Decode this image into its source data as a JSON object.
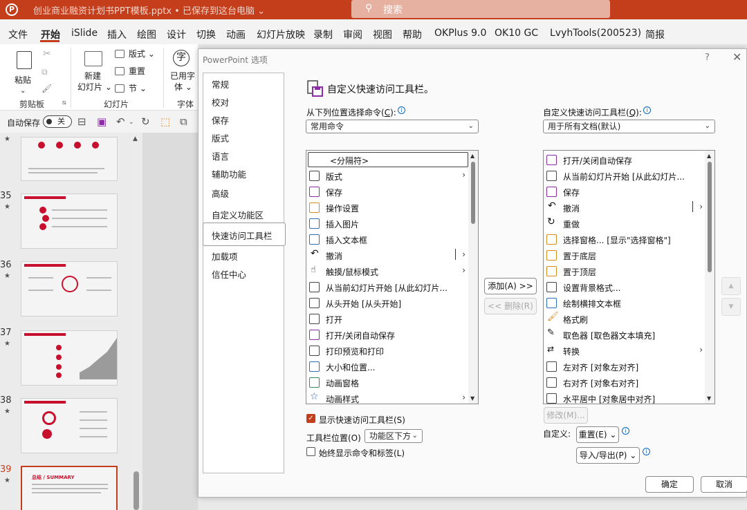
{
  "titlebar": {
    "doc_title": "创业商业融资计划书PPT模板.pptx • 已保存到这台电脑 ⌄",
    "search_placeholder": "搜索",
    "search_icon": "search-icon"
  },
  "menu": {
    "items": [
      "文件",
      "开始",
      "iSlide",
      "插入",
      "绘图",
      "设计",
      "切换",
      "动画",
      "幻灯片放映",
      "录制",
      "审阅",
      "视图",
      "帮助",
      "OKPlus 9.0",
      "OK10 GC",
      "LvyhTools(200523)",
      "简报"
    ],
    "active": "开始"
  },
  "ribbon": {
    "paste_label": "粘贴",
    "paste_chevron": "⌄",
    "new_slide_label_1": "新建",
    "new_slide_label_2": "幻灯片 ⌄",
    "layout_label": "版式 ⌄",
    "reset_label": "重置",
    "section_label": "节 ⌄",
    "font_btn_1": "已用字",
    "font_btn_2": "体 ⌄",
    "group_clipboard": "剪贴板",
    "group_slides": "幻灯片",
    "group_font": "字体"
  },
  "qat": {
    "autosave_label": "自动保存",
    "toggle_state": "关"
  },
  "slides": {
    "numbers": [
      "35",
      "36",
      "37",
      "38",
      "39"
    ],
    "star": "★",
    "current": "39",
    "thumb_caption": "总结 / SUMMARY"
  },
  "dialog": {
    "title": "PowerPoint 选项",
    "help": "?",
    "close": "✕",
    "nav": [
      "常规",
      "校对",
      "保存",
      "版式",
      "语言",
      "辅助功能",
      "高级",
      "自定义功能区",
      "快速访问工具栏",
      "加载项",
      "信任中心"
    ],
    "nav_selected": "快速访问工具栏",
    "section_title": "自定义快速访问工具栏。",
    "choose_label": "从下列位置选择命令(",
    "choose_key": "C",
    "choose_tail": "):",
    "choose_value": "常用命令",
    "customize_label": "自定义快速访问工具栏(",
    "customize_key": "Q",
    "customize_tail": "):",
    "customize_value": "用于所有文档(默认)",
    "left_list": [
      "<分隔符>",
      "版式",
      "保存",
      "操作设置",
      "插入图片",
      "插入文本框",
      "撤消",
      "触摸/鼠标模式",
      "从当前幻灯片开始 [从此幻灯片...",
      "从头开始 [从头开始]",
      "打开",
      "打开/关闭自动保存",
      "打印预览和打印",
      "大小和位置...",
      "动画窗格",
      "动画样式"
    ],
    "right_list": [
      "打开/关闭自动保存",
      "从当前幻灯片开始 [从此幻灯片...",
      "保存",
      "撤消",
      "重做",
      "选择窗格... [显示\"选择窗格\"]",
      "置于底层",
      "置于顶层",
      "设置背景格式...",
      "绘制横排文本框",
      "格式刷",
      "取色器 [取色器文本填充]",
      "转换",
      "左对齐 [对象左对齐]",
      "右对齐 [对象右对齐]",
      "水平居中 [对象居中对齐]"
    ],
    "add_btn": "添加(A) >>",
    "remove_btn": "<< 删除(R)",
    "modify_btn": "修改(M)...",
    "show_qat_label": "显示快速访问工具栏(S)",
    "show_qat_checked": true,
    "position_label": "工具栏位置(O)",
    "position_value": "功能区下方",
    "always_label": "始终显示命令和标签(L)",
    "custom_label": "自定义:",
    "reset_btn": "重置(E) ⌄",
    "import_btn": "导入/导出(P) ⌄",
    "ok_btn": "确定",
    "cancel_btn": "取消",
    "info_icon": "ⓘ"
  },
  "colors": {
    "accent": "#c43e1c",
    "title_bg": "#c43e1c"
  }
}
